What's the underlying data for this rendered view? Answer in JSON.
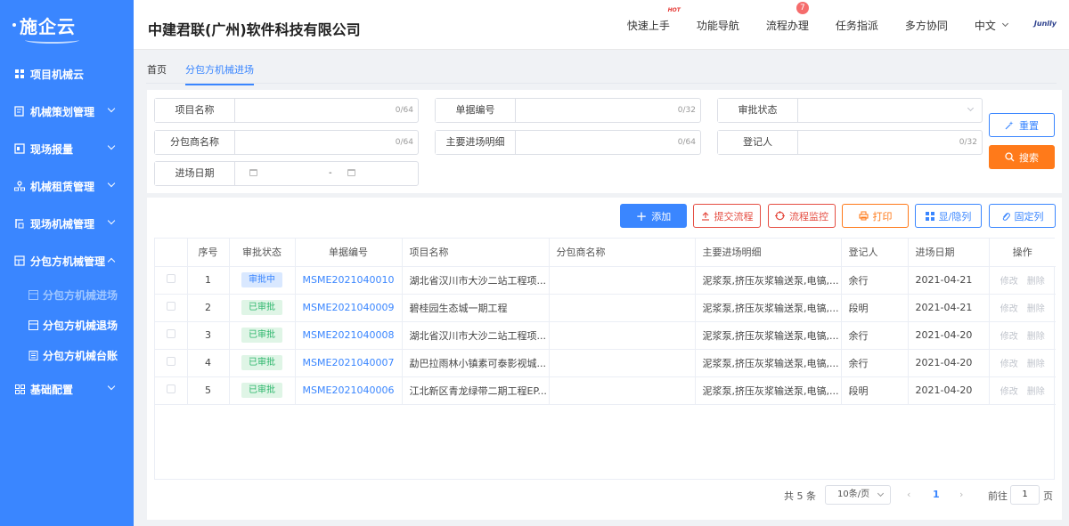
{
  "sidebar": {
    "logo": "施企云",
    "items": [
      {
        "label": "项目机械云",
        "icon": "grid-icon"
      },
      {
        "label": "机械策划管理",
        "icon": "plan-icon"
      },
      {
        "label": "现场报量",
        "icon": "report-icon"
      },
      {
        "label": "机械租赁管理",
        "icon": "org-icon"
      },
      {
        "label": "现场机械管理",
        "icon": "site-icon"
      },
      {
        "label": "分包方机械管理",
        "icon": "crane-icon"
      }
    ],
    "sub_items": [
      {
        "label": "分包方机械进场"
      },
      {
        "label": "分包方机械退场"
      },
      {
        "label": "分包方机械台账"
      }
    ],
    "last_item": {
      "label": "基础配置"
    }
  },
  "header": {
    "company": "中建君联(广州)软件科技有限公司",
    "nav": {
      "quick_start": "快速上手",
      "hot": "HOT",
      "function_nav": "功能导航",
      "process": "流程办理",
      "process_badge": "7",
      "task": "任务指派",
      "collab": "多方协同",
      "lang": "中文",
      "brand": "Junlly"
    }
  },
  "tabs": {
    "home": "首页",
    "current": "分包方机械进场"
  },
  "filter": {
    "project_name": {
      "label": "项目名称",
      "count": "0/64"
    },
    "doc_no": {
      "label": "单据编号",
      "count": "0/32"
    },
    "approval": {
      "label": "审批状态"
    },
    "subcontractor": {
      "label": "分包商名称",
      "count": "0/64"
    },
    "detail": {
      "label": "主要进场明细",
      "count": "0/64"
    },
    "registrant": {
      "label": "登记人",
      "count": "0/32"
    },
    "date": {
      "label": "进场日期",
      "sep": "-"
    },
    "reset": "重置",
    "search": "搜索"
  },
  "toolbar": {
    "add": "添加",
    "submit": "提交流程",
    "monitor": "流程监控",
    "print": "打印",
    "columns": "显/隐列",
    "fix": "固定列"
  },
  "table": {
    "headers": [
      "序号",
      "审批状态",
      "单据编号",
      "项目名称",
      "分包商名称",
      "主要进场明细",
      "登记人",
      "进场日期",
      "操作"
    ],
    "rows": [
      {
        "no": "1",
        "status": "审批中",
        "status_type": "pending",
        "doc": "MSME2021040010",
        "project": "湖北省汉川市大沙二站工程项...",
        "sub": "",
        "detail": "泥浆泵,挤压灰浆输送泵,电镐,...",
        "user": "余行",
        "date": "2021-04-21"
      },
      {
        "no": "2",
        "status": "已审批",
        "status_type": "ok",
        "doc": "MSME2021040009",
        "project": "碧桂园生态城一期工程",
        "sub": "",
        "detail": "泥浆泵,挤压灰浆输送泵,电镐,...",
        "user": "段明",
        "date": "2021-04-21"
      },
      {
        "no": "3",
        "status": "已审批",
        "status_type": "ok",
        "doc": "MSME2021040008",
        "project": "湖北省汉川市大沙二站工程项...",
        "sub": "",
        "detail": "泥浆泵,挤压灰浆输送泵,电镐,...",
        "user": "余行",
        "date": "2021-04-20"
      },
      {
        "no": "4",
        "status": "已审批",
        "status_type": "ok",
        "doc": "MSME2021040007",
        "project": "勐巴拉雨林小镇素可泰影视城...",
        "sub": "",
        "detail": "泥浆泵,挤压灰浆输送泵,电镐,...",
        "user": "余行",
        "date": "2021-04-20"
      },
      {
        "no": "5",
        "status": "已审批",
        "status_type": "ok",
        "doc": "MSME2021040006",
        "project": "江北新区青龙绿带二期工程EP...",
        "sub": "",
        "detail": "泥浆泵,挤压灰浆输送泵,电镐,...",
        "user": "段明",
        "date": "2021-04-20"
      }
    ],
    "op_edit": "修改",
    "op_delete": "删除"
  },
  "pager": {
    "total": "共 5 条",
    "size": "10条/页",
    "current": "1",
    "goto": "前往",
    "page_input": "1",
    "unit": "页"
  }
}
